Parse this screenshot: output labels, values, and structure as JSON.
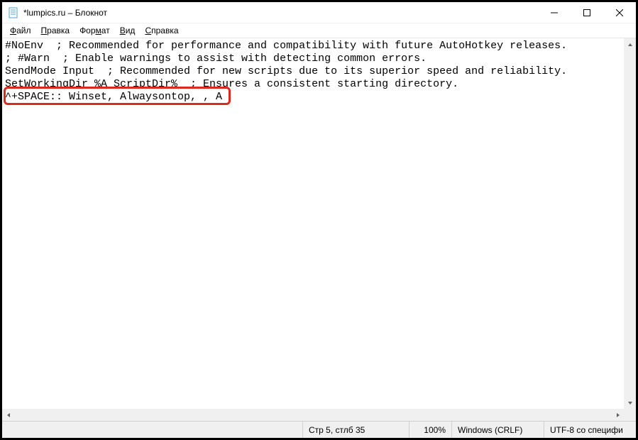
{
  "window": {
    "title": "*lumpics.ru – Блокнот"
  },
  "menu": {
    "file": "Файл",
    "edit": "Правка",
    "format": "Формат",
    "view": "Вид",
    "help": "Справка"
  },
  "editor": {
    "line1": "#NoEnv  ; Recommended for performance and compatibility with future AutoHotkey releases.",
    "line2": "; #Warn  ; Enable warnings to assist with detecting common errors.",
    "line3": "SendMode Input  ; Recommended for new scripts due to its superior speed and reliability.",
    "line4": "SetWorkingDir %A_ScriptDir%  ; Ensures a consistent starting directory.",
    "line5": "^+SPACE:: Winset, Alwaysontop, , A"
  },
  "status": {
    "position": "Стр 5, стлб 35",
    "zoom": "100%",
    "line_ending": "Windows (CRLF)",
    "encoding": "UTF-8 со специфи"
  }
}
